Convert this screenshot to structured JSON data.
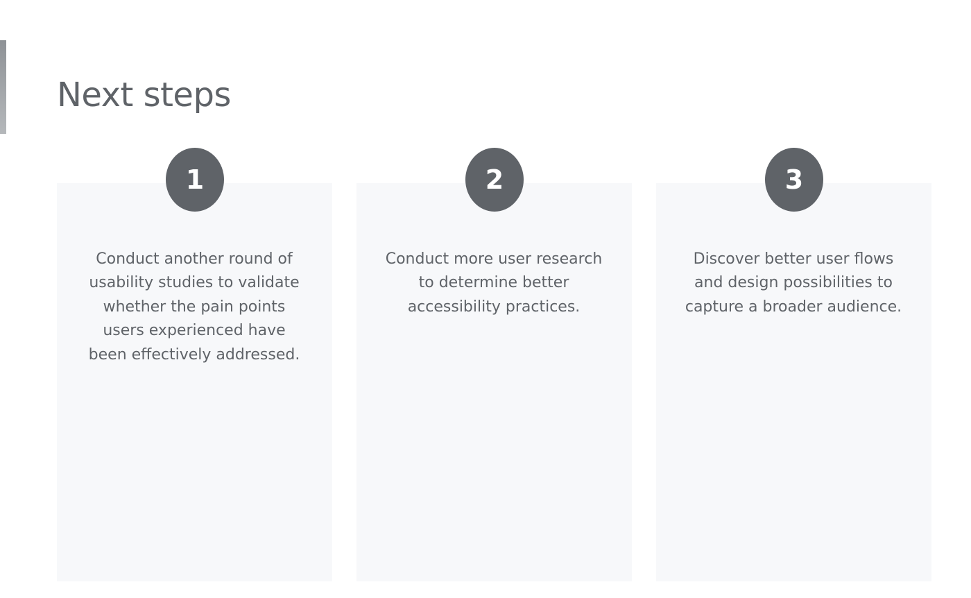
{
  "page": {
    "title": "Next steps"
  },
  "steps": [
    {
      "number": "1",
      "text": "Conduct another round of usability studies to validate whether the pain points users experienced have been effectively addressed."
    },
    {
      "number": "2",
      "text": "Conduct more user research to determine better accessibility practices."
    },
    {
      "number": "3",
      "text": "Discover better user flows and design possibilities to capture a broader audience."
    }
  ],
  "colors": {
    "text": "#5f6368",
    "badge": "#5f6368",
    "card_background": "#f7f8fa",
    "accent_bar": "#9a9ea2"
  }
}
